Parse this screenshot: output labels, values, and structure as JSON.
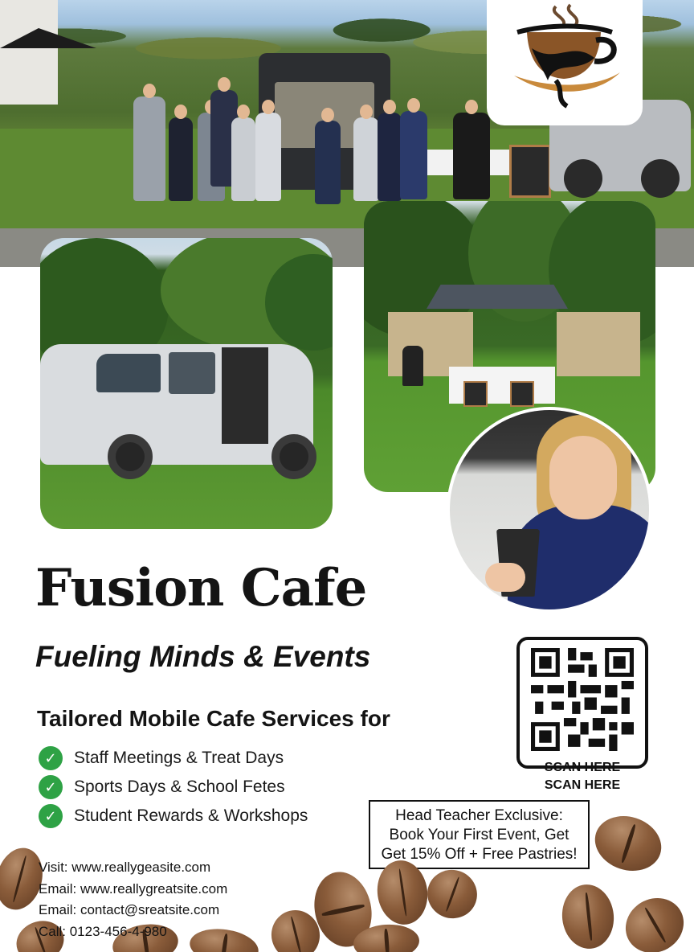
{
  "brand": {
    "name": "Fusion Cafe",
    "tagline": "Fueling Minds & Events"
  },
  "services": {
    "heading": "Tailored Mobile Cafe Services for",
    "items": [
      "Staff Meetings & Treat Days",
      "Sports Days & School Fetes",
      "Student Rewards & Workshops"
    ]
  },
  "qr": {
    "label_1": "SCAN HERE",
    "label_2": "SCAN HERE"
  },
  "offer": {
    "line_1": "Head Teacher Exclusive:",
    "line_2": "Book Your First Event, Get",
    "line_3": "Get 15% Off + Free Pastries!"
  },
  "contact": {
    "visit": "Visit: www.reallygeasite.com",
    "email_1": "Email: www.reallygreatsite.com",
    "email_2": "Email: contact@sreatsite.com",
    "call": "Call: 0123-456-4-980"
  },
  "colors": {
    "check_green": "#2ea245",
    "text_dark": "#141414",
    "coffee_brown": "#8a5c3a"
  },
  "icons": [
    "coffee-cup-logo-icon",
    "check-circle-icon",
    "qr-code-icon",
    "coffee-bean-icon"
  ]
}
